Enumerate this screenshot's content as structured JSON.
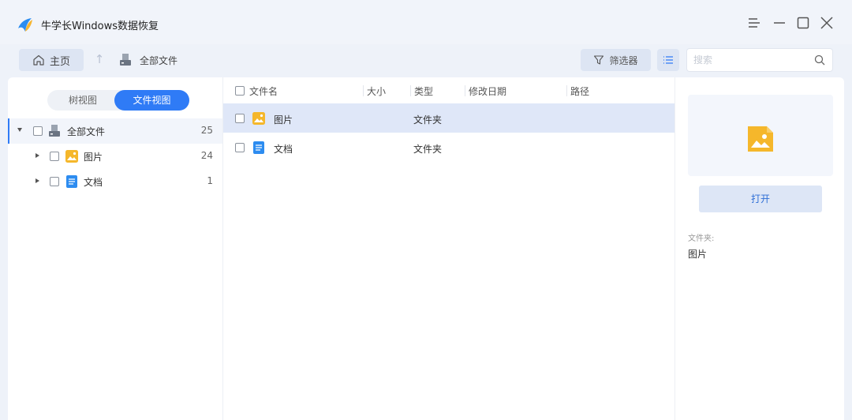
{
  "app": {
    "title": "牛学长Windows数据恢复"
  },
  "toolbar": {
    "home_label": "主页",
    "breadcrumb_label": "全部文件",
    "filter_label": "筛选器",
    "search_placeholder": "搜索"
  },
  "sidebar": {
    "view_tabs": [
      {
        "label": "树视图",
        "active": false
      },
      {
        "label": "文件视图",
        "active": true
      }
    ],
    "tree": [
      {
        "label": "全部文件",
        "count": "25",
        "expanded": true,
        "icon": "drive-icon"
      },
      {
        "label": "图片",
        "count": "24",
        "expanded": false,
        "icon": "image-folder-icon"
      },
      {
        "label": "文档",
        "count": "1",
        "expanded": false,
        "icon": "document-folder-icon"
      }
    ]
  },
  "file_list": {
    "columns": [
      "文件名",
      "大小",
      "类型",
      "修改日期",
      "路径"
    ],
    "rows": [
      {
        "name": "图片",
        "size": "",
        "type": "文件夹",
        "date": "",
        "path": "",
        "icon": "image-folder-icon",
        "selected": true
      },
      {
        "name": "文档",
        "size": "",
        "type": "文件夹",
        "date": "",
        "path": "",
        "icon": "document-folder-icon",
        "selected": false
      }
    ]
  },
  "preview": {
    "open_label": "打开",
    "meta_label": "文件夹:",
    "meta_value": "图片"
  },
  "colors": {
    "accent": "#2f7bf6",
    "selected_row": "#dfe7f8",
    "image_icon": "#f5b72b",
    "doc_icon": "#2d8cf0"
  }
}
